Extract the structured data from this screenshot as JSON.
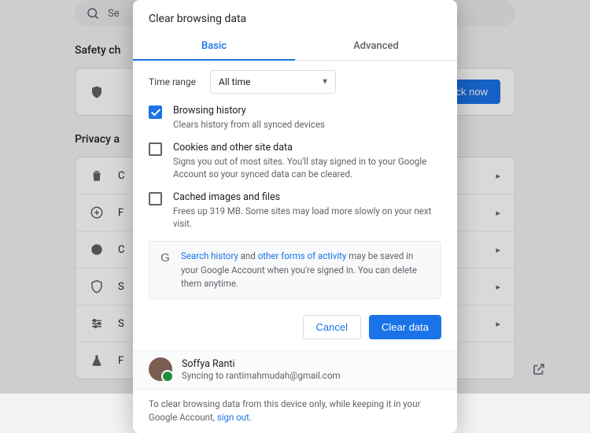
{
  "bg": {
    "search_placeholder": "Se",
    "safety_heading": "Safety ch",
    "checknow": "Check now",
    "privacy_heading": "Privacy a",
    "rows": [
      {
        "label": "C"
      },
      {
        "label": "F"
      },
      {
        "label": "C"
      },
      {
        "label": "S"
      },
      {
        "label": "S"
      },
      {
        "label": "F"
      }
    ]
  },
  "dialog": {
    "title": "Clear browsing data",
    "tabs": {
      "basic": "Basic",
      "advanced": "Advanced"
    },
    "time_label": "Time range",
    "time_value": "All time",
    "options": [
      {
        "label": "Browsing history",
        "desc": "Clears history from all synced devices",
        "checked": true
      },
      {
        "label": "Cookies and other site data",
        "desc": "Signs you out of most sites. You'll stay signed in to your Google Account so your synced data can be cleared.",
        "checked": false
      },
      {
        "label": "Cached images and files",
        "desc": "Frees up 319 MB. Some sites may load more slowly on your next visit.",
        "checked": false
      }
    ],
    "notice": {
      "link1": "Search history",
      "mid1": " and ",
      "link2": "other forms of activity",
      "rest": " may be saved in your Google Account when you're signed in. You can delete them anytime."
    },
    "cancel": "Cancel",
    "clear": "Clear data",
    "user": {
      "name": "Soffya Ranti",
      "status": "Syncing to rantimahmudah@gmail.com"
    },
    "footnote": {
      "pre": "To clear browsing data from this device only, while keeping it in your Google Account, ",
      "link": "sign out",
      "post": "."
    }
  }
}
